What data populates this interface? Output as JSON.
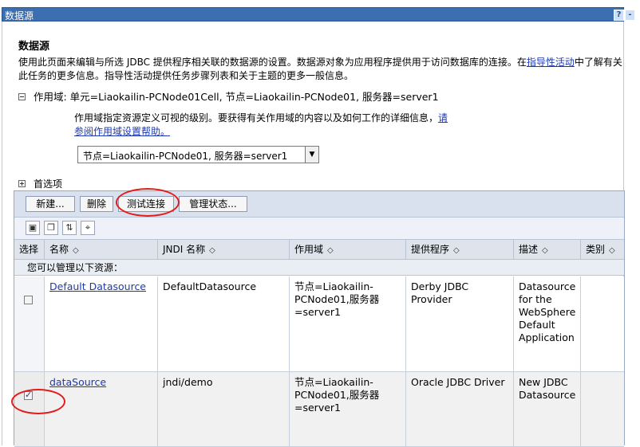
{
  "titlebar": {
    "title": "数据源",
    "help": "?",
    "minimize": "-"
  },
  "heading": "数据源",
  "description": {
    "text": "使用此页面来编辑与所选 JDBC 提供程序相关联的数据源的设置。数据源对象为应用程序提供用于访问数据库的连接。在",
    "link": "指导性活动",
    "text2": "中了解有关此任务的更多信息。指导性活动提供任务步骤列表和关于主题的更多一般信息。"
  },
  "scope": {
    "label_prefix": "作用域: 单元=Liaokailin-PCNode01Cell, 节点=Liaokailin-PCNode01, 服务器=server1",
    "help_text": "作用域指定资源定义可视的级别。要获得有关作用域的内容以及如何工作的详细信息，",
    "help_link": "请参阅作用域设置帮助。",
    "selected": "节点=Liaokailin-PCNode01, 服务器=server1"
  },
  "preferences": "首选项",
  "toolbar": {
    "new": "新建...",
    "delete": "删除",
    "test_connection": "测试连接",
    "manage_state": "管理状态..."
  },
  "table": {
    "headers": [
      "选择",
      "名称",
      "JNDI 名称",
      "作用域",
      "提供程序",
      "描述",
      "类别"
    ],
    "info": "您可以管理以下资源：",
    "rows": [
      {
        "checked": false,
        "name": "Default Datasource",
        "jndi": "DefaultDatasource",
        "scope": "节点=Liaokailin-PCNode01,服务器=server1",
        "provider": "Derby JDBC Provider",
        "description": "Datasource for the WebSphere Default Application",
        "category": ""
      },
      {
        "checked": true,
        "name": "dataSource",
        "jndi": "jndi/demo",
        "scope": "节点=Liaokailin-PCNode01,服务器=server1",
        "provider": "Oracle JDBC Driver",
        "description": "New JDBC Datasource",
        "category": ""
      }
    ]
  },
  "colors": {
    "titlebar": "#3b6fb2",
    "link": "#1c39b3",
    "annotation": "#e21b1b"
  }
}
